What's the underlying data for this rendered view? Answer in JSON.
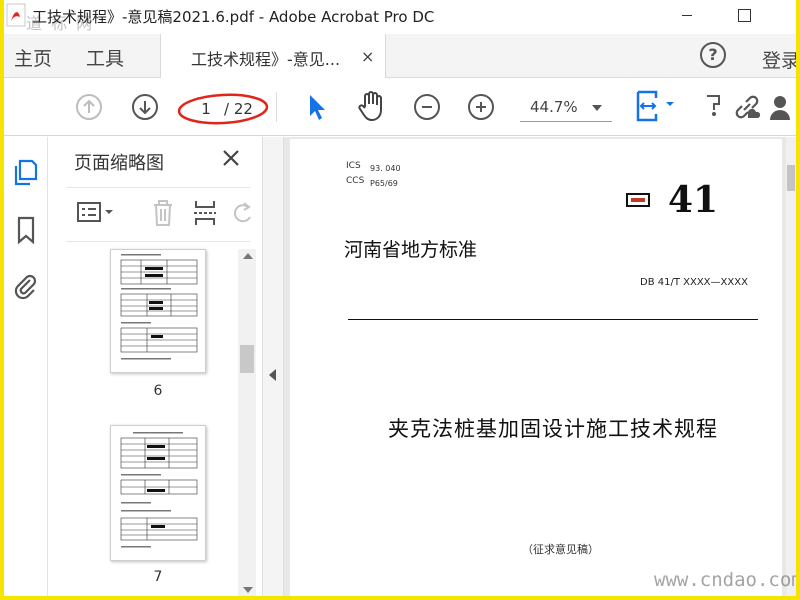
{
  "window": {
    "title": "工技术规程》-意见稿2021.6.pdf - Adobe Acrobat Pro DC",
    "watermark": "道 标 网"
  },
  "menu": {
    "home": "主页",
    "tools": "工具",
    "doc_tab": "工技术规程》-意见...",
    "doc_tab_close": "×",
    "help": "?",
    "login": "登录"
  },
  "toolbar": {
    "current_page": "1",
    "total_pages": "/ 22",
    "zoom": "44.7%"
  },
  "panel": {
    "title": "页面缩略图",
    "thumbnails": [
      {
        "label": "6"
      },
      {
        "label": "7"
      }
    ]
  },
  "document": {
    "ics_label": "ICS",
    "ics_value": "93. 040",
    "ccs_label": "CCS",
    "ccs_value": "P65/69",
    "standard_number": "41",
    "org": "河南省地方标准",
    "code": "DB 41/T  XXXX—XXXX",
    "title": "夹克法桩基加固设计施工技术规程",
    "note": "（征求意见稿）"
  },
  "site_watermark": "www.cndao.com",
  "colors": {
    "frame": "#f5e400",
    "accent_blue": "#1473e6",
    "annotation_red": "#e0251b",
    "badge_red": "#c0392b"
  },
  "icons": {
    "app": "pdf-app-icon",
    "prev": "arrow-up-circle-icon",
    "next": "arrow-down-circle-icon",
    "select": "cursor-arrow-icon",
    "hand": "hand-icon",
    "zoom_out": "minus-circle-icon",
    "zoom_in": "plus-circle-icon",
    "pages": "pages-icon",
    "bookmark": "bookmark-icon",
    "attach": "paperclip-icon"
  }
}
